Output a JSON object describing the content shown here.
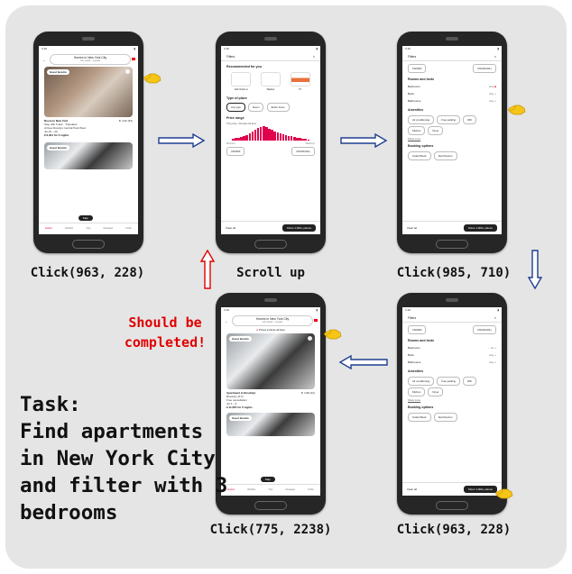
{
  "task": {
    "heading": "Task:",
    "lines": [
      "Find apartments",
      "in New York City",
      "and filter with 3",
      "bedrooms"
    ]
  },
  "note": {
    "line1": "Should be",
    "line2": "completed!"
  },
  "steps": [
    {
      "caption": "Click(963, 228)"
    },
    {
      "caption": "Scroll up"
    },
    {
      "caption": "Click(985, 710)"
    },
    {
      "caption": "Click(963, 228)"
    },
    {
      "caption": "Click(775, 2238)"
    }
  ],
  "screens": {
    "search": {
      "time": "3:18",
      "title": "Homes in New York City",
      "sub": "Any week · 1 guest",
      "badge": "Guest favorite",
      "listing_title": "Room in New York",
      "rating": "★ 4.92 (84)",
      "line1": "Stay with Frank · Translator",
      "line2": "Arrives Rosslyn Central Park West",
      "line3": "Jul 16 – 20",
      "price": "¥ 6,321 for 5 nights",
      "badge2": "Guest favorite",
      "map": "Map",
      "nav": [
        "Explore",
        "Wishlists",
        "Trips",
        "Messages",
        "Profile"
      ]
    },
    "filters1": {
      "title": "Filters",
      "close": "×",
      "recommended": "Recommended for you",
      "rec_items": [
        "Self check-in",
        "Washer",
        "TV"
      ],
      "type_heading": "Type of place",
      "types": [
        "Any type",
        "Room",
        "Entire home"
      ],
      "price_heading": "Price range",
      "price_sub": "Trip price, includes all fees",
      "min_label": "Minimum",
      "max_label": "Maximum",
      "min": "CN¥260",
      "max": "CN¥18,000+",
      "clear": "Clear all",
      "show": "Show 1,000+ places"
    },
    "filters2": {
      "title": "Filters",
      "min": "CN¥260",
      "max": "CN¥18,000+",
      "rooms_heading": "Rooms and beds",
      "rows": [
        {
          "label": "Bedrooms",
          "value": "Any"
        },
        {
          "label": "Beds",
          "value": "Any"
        },
        {
          "label": "Bathrooms",
          "value": "Any"
        }
      ],
      "amen_heading": "Amenities",
      "amen": [
        "Air conditioning",
        "Free parking",
        "Wifi",
        "Kitchen",
        "Dryer"
      ],
      "show_more": "Show more",
      "booking_heading": "Booking options",
      "booking": [
        "Instant Book",
        "Self check-in"
      ],
      "clear": "Clear all",
      "show": "Show 1,000+ places"
    },
    "filters3": {
      "rows": [
        {
          "label": "Bedrooms",
          "value": "3+"
        },
        {
          "label": "Beds",
          "value": "Any"
        },
        {
          "label": "Bathrooms",
          "value": "Any"
        }
      ],
      "show": "Show 1,000+ places"
    },
    "result": {
      "prices_banner": "Prices include all fees",
      "listing_title": "Apartment in Brooklyn",
      "rating": "★ 4.98 (22)",
      "line1": "Brooklyn 11 br",
      "line2": "Free cancellation",
      "line3": "Jul 1 – 6",
      "price": "¥ 11,087 for 5 nights",
      "map": "Map"
    }
  }
}
